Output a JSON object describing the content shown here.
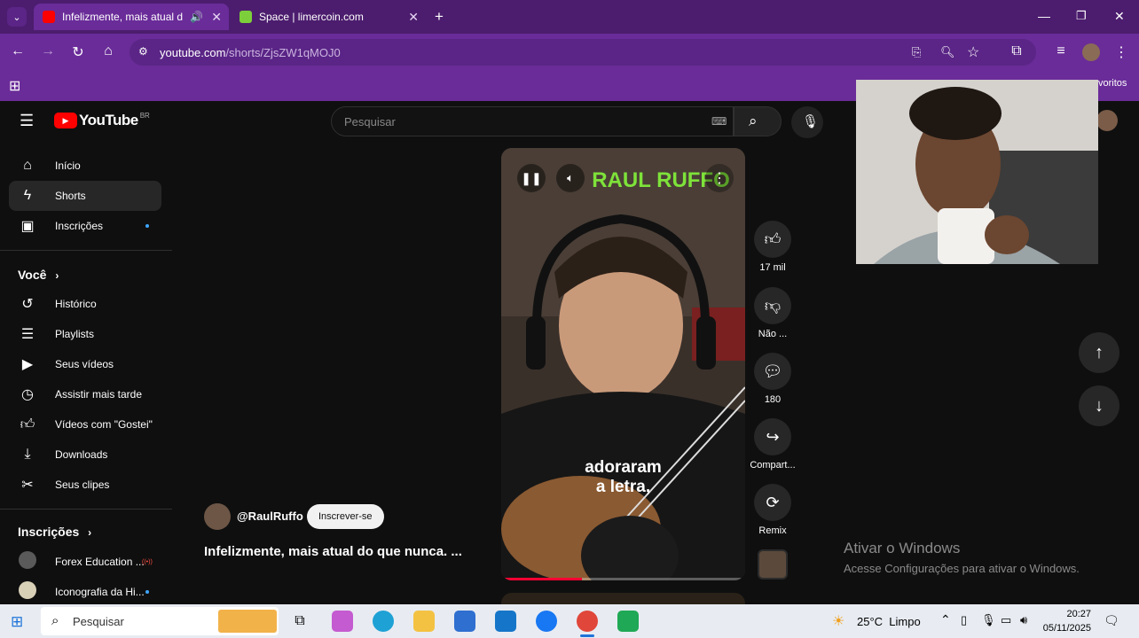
{
  "browser": {
    "tabs": [
      {
        "title": "Infelizmente, mais atual do",
        "active": true
      },
      {
        "title": "Space | limercoin.com",
        "active": false
      }
    ],
    "url_host": "youtube.com",
    "url_path": "/shorts/ZjsZW1qMOJ0",
    "bookmarks_partial": "voritos"
  },
  "youtube": {
    "logo": "YouTube",
    "logo_region": "BR",
    "search_placeholder": "Pesquisar",
    "sidebar": {
      "main": [
        {
          "label": "Início",
          "icon": "home-icon"
        },
        {
          "label": "Shorts",
          "icon": "shorts-icon",
          "active": true
        },
        {
          "label": "Inscrições",
          "icon": "subscriptions-icon"
        }
      ],
      "you_heading": "Você",
      "you": [
        {
          "label": "Histórico",
          "icon": "history-icon"
        },
        {
          "label": "Playlists",
          "icon": "playlists-icon"
        },
        {
          "label": "Seus vídeos",
          "icon": "your-videos-icon"
        },
        {
          "label": "Assistir mais tarde",
          "icon": "watch-later-icon"
        },
        {
          "label": "Vídeos com \"Gostei\"",
          "icon": "liked-icon"
        },
        {
          "label": "Downloads",
          "icon": "download-icon"
        },
        {
          "label": "Seus clipes",
          "icon": "clips-icon"
        }
      ],
      "subs_heading": "Inscrições",
      "subs": [
        {
          "label": "Forex Education ..."
        },
        {
          "label": "Iconografia da Hi..."
        }
      ]
    },
    "short": {
      "channel": "@RaulRuffo",
      "subscribe": "Inscrever-se",
      "title": "Infelizmente, mais atual do que nunca. ...",
      "caption_line1": "adoraram",
      "caption_line2": "a letra,",
      "overlay_brand": "RAUL RUFFO",
      "progress": 0.33
    },
    "actions": [
      {
        "icon": "like-icon",
        "label": "17 mil"
      },
      {
        "icon": "dislike-icon",
        "label": "Não ..."
      },
      {
        "icon": "comments-icon",
        "label": "180"
      },
      {
        "icon": "share-icon",
        "label": "Compart..."
      },
      {
        "icon": "remix-icon",
        "label": "Remix"
      }
    ]
  },
  "windows_activation": {
    "title": "Ativar o Windows",
    "subtitle": "Acesse Configurações para ativar o Windows."
  },
  "taskbar": {
    "search": "Pesquisar",
    "weather": "25°C  Limpo",
    "time": "20:27",
    "date": "05/11/2025"
  }
}
